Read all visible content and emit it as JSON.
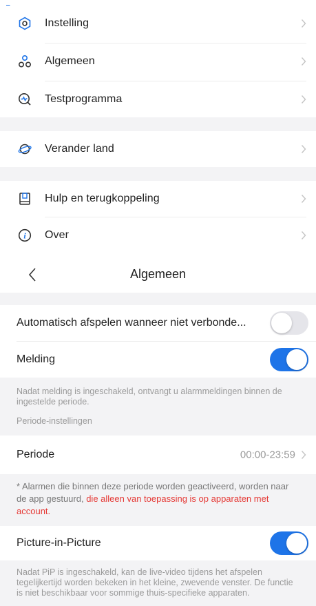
{
  "colors": {
    "accent": "#1e74e8",
    "warning_red": "#e53935",
    "section_gap": "#f3f3f5"
  },
  "menu": {
    "items": [
      {
        "label": "Instelling",
        "icon": "settings-hexagon-icon"
      },
      {
        "label": "Algemeen",
        "icon": "general-nodes-icon"
      },
      {
        "label": "Testprogramma",
        "icon": "test-program-icon"
      },
      {
        "label": "Verander land",
        "icon": "planet-icon"
      },
      {
        "label": "Hulp en terugkoppeling",
        "icon": "help-book-icon"
      },
      {
        "label": "Over",
        "icon": "info-icon"
      }
    ]
  },
  "general": {
    "title": "Algemeen",
    "auto_play": {
      "label": "Automatisch afspelen wanneer niet verbonde...",
      "enabled": false
    },
    "notification": {
      "label": "Melding",
      "enabled": true
    },
    "notification_note": "Nadat melding is ingeschakeld, ontvangt u alarmmeldingen binnen de ingestelde periode.",
    "period_settings_header": "Periode-instellingen",
    "period": {
      "label": "Periode",
      "value": "00:00-23:59"
    },
    "alarm_note_plain": "* Alarmen die binnen deze periode worden geactiveerd, worden naar de app gestuurd, ",
    "alarm_note_red": "die alleen van toepassing is op apparaten met account.",
    "pip": {
      "label": "Picture-in-Picture",
      "enabled": true
    },
    "pip_note": "Nadat PiP is ingeschakeld, kan de live-video tijdens het afspelen tegelijkertijd worden bekeken in het kleine, zwevende venster. De functie is niet beschikbaar voor sommige thuis-specifieke apparaten."
  }
}
